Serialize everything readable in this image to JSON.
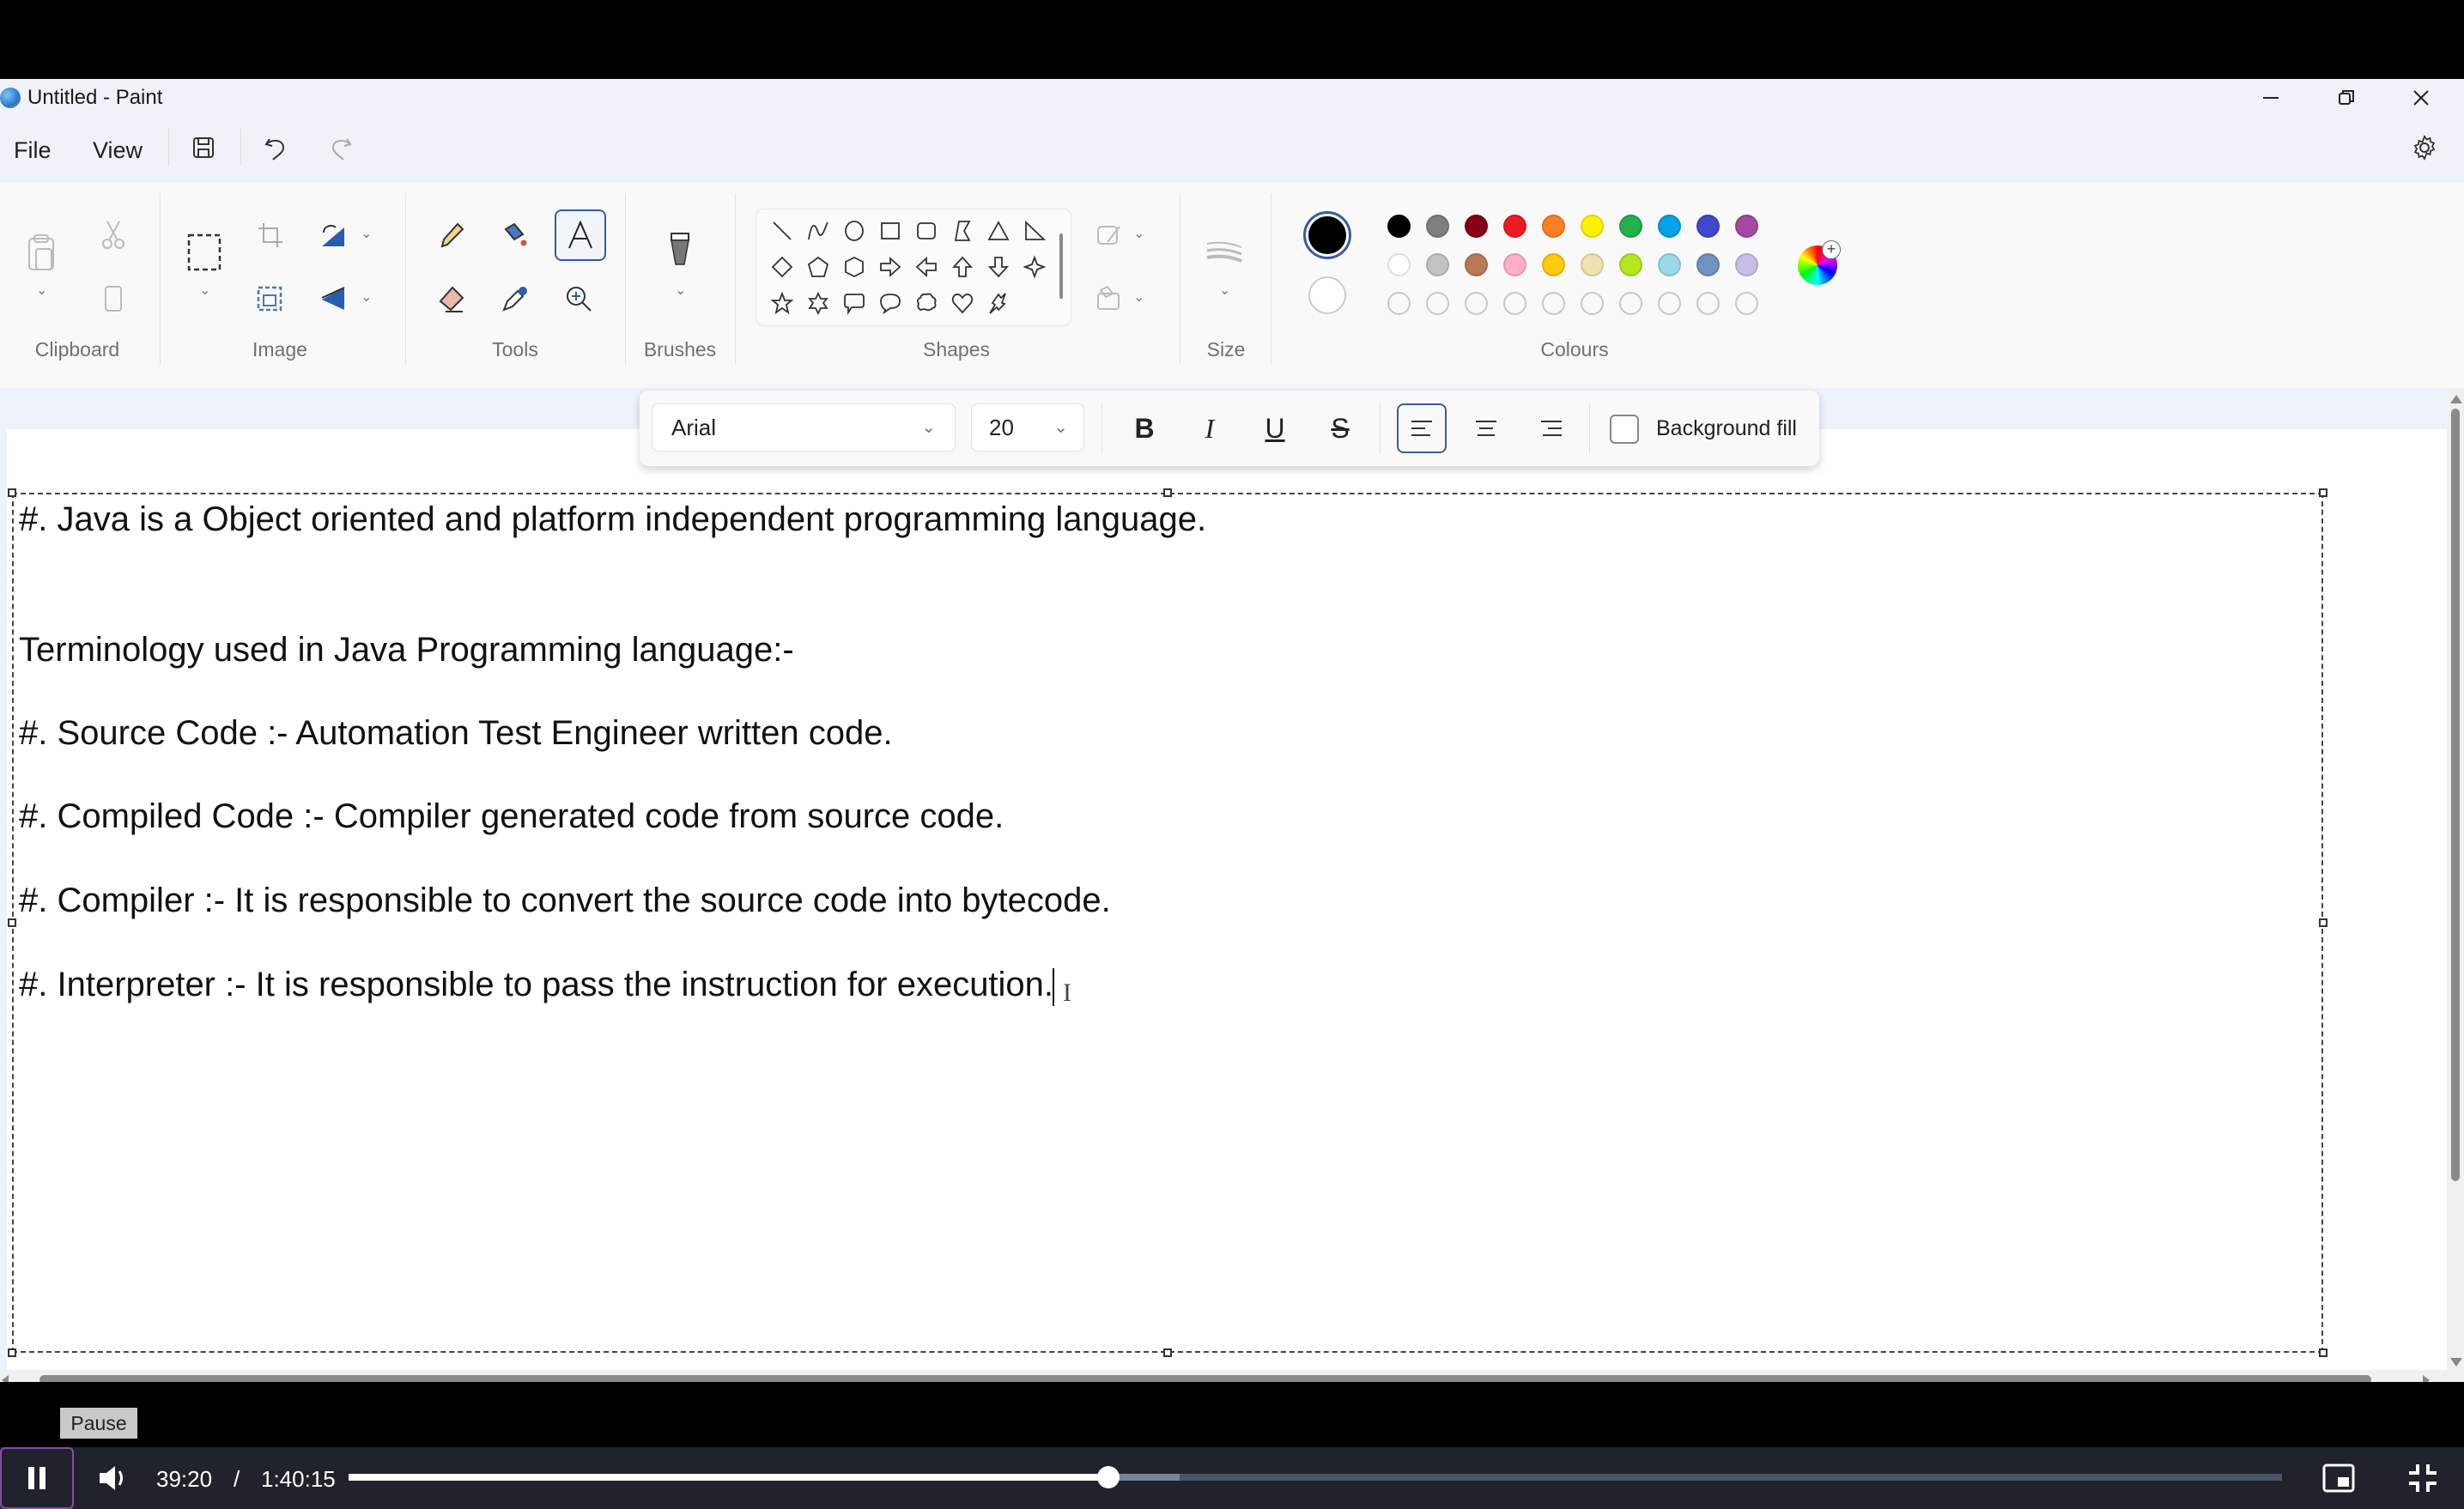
{
  "window": {
    "title": "Untitled - Paint",
    "controls": {
      "minimize": "minimize-icon",
      "restore": "restore-icon",
      "close": "close-icon"
    }
  },
  "menu": {
    "file": "File",
    "view": "View",
    "save_icon": "save-icon",
    "undo_icon": "undo-icon",
    "redo_icon": "redo-icon",
    "settings_icon": "gear-icon"
  },
  "ribbon": {
    "groups": {
      "clipboard": "Clipboard",
      "image": "Image",
      "tools": "Tools",
      "brushes": "Brushes",
      "shapes": "Shapes",
      "size": "Size",
      "colours": "Colours"
    },
    "selected_tool": "text",
    "shapes": [
      "line",
      "curve",
      "oval",
      "rectangle",
      "rounded-rectangle",
      "polygon",
      "triangle",
      "right-triangle",
      "diamond",
      "pentagon",
      "hexagon",
      "right-arrow",
      "left-arrow",
      "up-arrow",
      "down-arrow",
      "four-point-star",
      "five-point-star",
      "six-point-star",
      "rounded-callout",
      "oval-callout",
      "cloud-callout",
      "heart",
      "lightning"
    ],
    "colours": {
      "primary": "#000000",
      "secondary": "#ffffff",
      "row1": [
        "#000000",
        "#7f7f7f",
        "#880015",
        "#ed1c24",
        "#ff7f27",
        "#fff200",
        "#22b14c",
        "#00a2e8",
        "#3f48cc",
        "#a349a4"
      ],
      "row2": [
        "#ffffff",
        "#c3c3c3",
        "#b97a57",
        "#ffaec9",
        "#ffc90e",
        "#efe4b0",
        "#b5e61d",
        "#99d9ea",
        "#7092be",
        "#c8bfe7"
      ],
      "row3_custom_count": 10
    }
  },
  "text_toolbar": {
    "font": "Arial",
    "size": "20",
    "bold": "B",
    "italic": "I",
    "underline": "U",
    "strikethrough": "S",
    "alignment": "left",
    "background_fill_label": "Background fill",
    "background_fill_checked": false
  },
  "canvas": {
    "lines": [
      "#. Java is a Object oriented and platform independent programming language.",
      "Terminology used in Java Programming language:-",
      "#. Source Code :- Automation Test Engineer written code.",
      "#. Compiled Code :- Compiler generated code from source code.",
      "#. Compiler :- It is responsible to convert the source code into bytecode.",
      "#. Interpreter :- It is responsible to pass the instruction for execution."
    ]
  },
  "player": {
    "tooltip": "Pause",
    "current_time": "39:20",
    "separator": "/",
    "total_time": "1:40:15",
    "progress_fraction": 0.393,
    "buffered_fraction": 0.43
  }
}
